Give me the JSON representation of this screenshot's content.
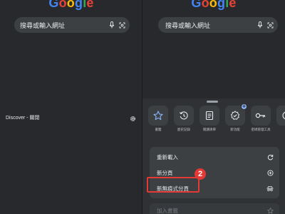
{
  "left": {
    "logo": [
      {
        "ch": "G",
        "color": "#4285F4"
      },
      {
        "ch": "o",
        "color": "#EA4335"
      },
      {
        "ch": "o",
        "color": "#FBBC05"
      },
      {
        "ch": "g",
        "color": "#4285F4"
      },
      {
        "ch": "l",
        "color": "#34A853"
      },
      {
        "ch": "e",
        "color": "#EA4335"
      }
    ],
    "search_placeholder": "搜尋或輸入網址",
    "discover_label": "Discover - 關閉"
  },
  "right": {
    "search_placeholder": "搜尋或輸入網址",
    "shortcuts": [
      {
        "label": "書籤",
        "icon": "star-icon"
      },
      {
        "label": "歷史記錄",
        "icon": "history-icon"
      },
      {
        "label": "閱讀清單",
        "icon": "reading-list-icon"
      },
      {
        "label": "新功能",
        "icon": "whats-new-icon"
      },
      {
        "label": "密碼管理工具",
        "icon": "key-icon"
      },
      {
        "label": "",
        "icon": "partial-icon"
      }
    ],
    "menu": [
      {
        "label": "重新載入",
        "icon": "reload-icon"
      },
      {
        "label": "新分頁",
        "icon": "add-circle-icon"
      },
      {
        "label": "新無痕式分頁",
        "icon": "incognito-icon"
      }
    ],
    "bottom_item": {
      "label": "加入書籤",
      "icon": "star-outline-icon"
    },
    "callout_number": "2"
  },
  "colors": {
    "background": "#28292c",
    "sheet": "#303134",
    "menu": "#3c4043",
    "highlight": "#e53935"
  }
}
